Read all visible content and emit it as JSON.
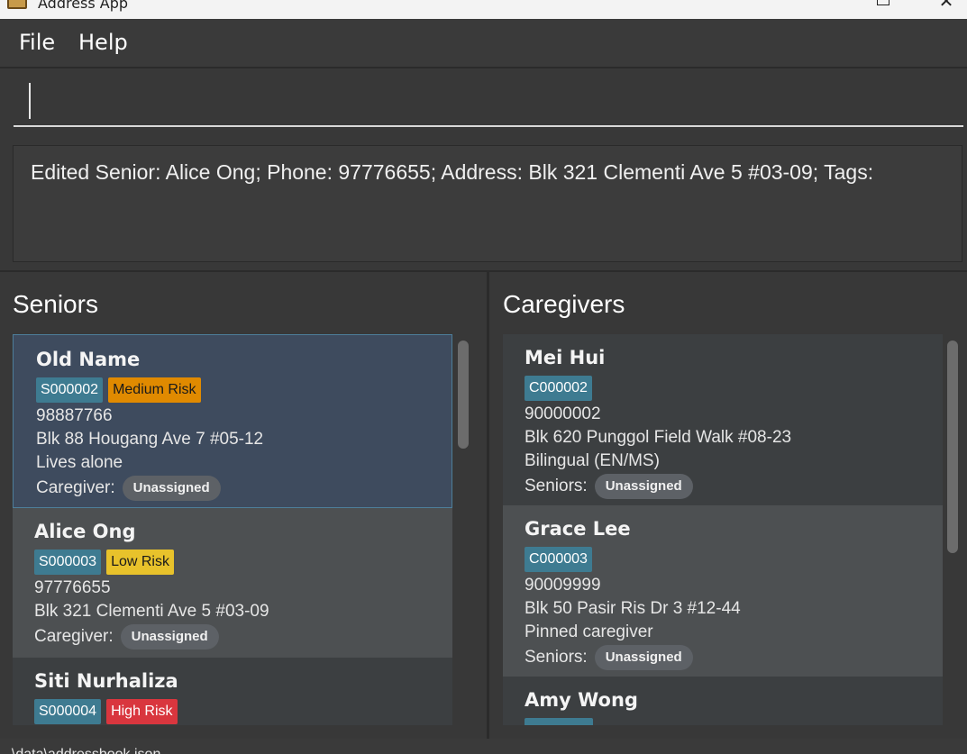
{
  "window": {
    "title": "Address App"
  },
  "menu": {
    "items": [
      {
        "label": "File"
      },
      {
        "label": "Help"
      }
    ]
  },
  "command": {
    "value": ""
  },
  "result": {
    "text": "Edited Senior: Alice Ong; Phone: 97776655; Address: Blk 321 Clementi Ave 5 #03-09; Tags:"
  },
  "seniors": {
    "title": "Seniors",
    "cards": [
      {
        "name": "Old Name",
        "id": "S000002",
        "risk": "Medium Risk",
        "phone": "98887766",
        "address": "Blk 88 Hougang Ave 7 #05-12",
        "note": "Lives alone",
        "assign_label": "Caregiver:",
        "assign_value": "Unassigned"
      },
      {
        "name": "Alice Ong",
        "id": "S000003",
        "risk": "Low Risk",
        "phone": "97776655",
        "address": "Blk 321 Clementi Ave 5 #03-09",
        "assign_label": "Caregiver:",
        "assign_value": "Unassigned"
      },
      {
        "name": "Siti Nurhaliza",
        "id": "S000004",
        "risk": "High Risk"
      }
    ]
  },
  "caregivers": {
    "title": "Caregivers",
    "cards": [
      {
        "name": "Mei Hui",
        "id": "C000002",
        "phone": "90000002",
        "address": "Blk 620 Punggol Field Walk #08-23",
        "note": "Bilingual (EN/MS)",
        "assign_label": "Seniors:",
        "assign_value": "Unassigned"
      },
      {
        "name": "Grace Lee",
        "id": "C000003",
        "phone": "90009999",
        "address": "Blk 50 Pasir Ris Dr 3 #12-44",
        "note": "Pinned caregiver",
        "assign_label": "Seniors:",
        "assign_value": "Unassigned"
      },
      {
        "name": "Amy Wong"
      }
    ]
  },
  "status": {
    "text": "..\\data\\addressbook.json"
  },
  "colors": {
    "id_tag": "#3e7b91",
    "medium_risk": "#e08a00",
    "low_risk": "#e8c22b",
    "high_risk": "#d9363e",
    "selected_border": "#4d7e9a"
  }
}
